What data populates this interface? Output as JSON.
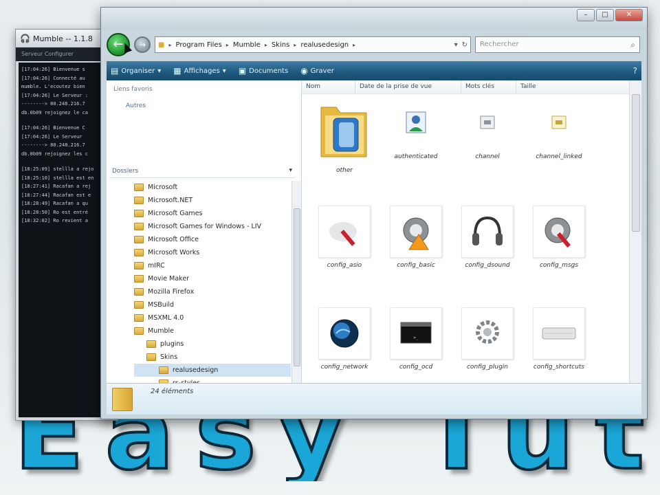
{
  "mumble": {
    "title": "Mumble -- 1.1.8",
    "menu": "Serveur  Configurer",
    "log_lines": [
      "[17:04:26] Bienvenue s",
      "[17:04:26] Connecté au",
      "mumble. L'ecoutez bien",
      "[17:04:26] Le Serveur :",
      "--------> 80.248.216.7",
      "db.0b09 rejoignez le ca",
      "",
      "[17:04:26] Bienvenue C",
      "[17:04:26] Le Serveur",
      "--------> 80.248.216.7",
      "db.0b09 rejoignez les c",
      "",
      "[18:25:09] stellla a rejo",
      "[18:25:10] stellla est en",
      "[18:27:41] Racafan a rej",
      "[18:27:44] Racafan est e",
      "[18:28:49] Racafan a qu",
      "[18:28:50] Ro est entré",
      "[18:32:02] Ro revient a"
    ]
  },
  "explorer": {
    "address": {
      "parts": [
        "Program Files",
        "Mumble",
        "Skins",
        "realusedesign"
      ]
    },
    "search_placeholder": "Rechercher",
    "toolbar": {
      "organize": "Organiser",
      "views": "Affichages",
      "burn": "Graver",
      "documents": "Documents"
    },
    "nav": {
      "favorites_header": "Liens favoris",
      "favorites_item": "Autres",
      "folders_header": "Dossiers",
      "folders": [
        {
          "label": "Microsoft",
          "level": 0
        },
        {
          "label": "Microsoft.NET",
          "level": 0
        },
        {
          "label": "Microsoft Games",
          "level": 0
        },
        {
          "label": "Microsoft Games for Windows - LIV",
          "level": 0
        },
        {
          "label": "Microsoft Office",
          "level": 0
        },
        {
          "label": "Microsoft Works",
          "level": 0
        },
        {
          "label": "mIRC",
          "level": 0
        },
        {
          "label": "Movie Maker",
          "level": 0
        },
        {
          "label": "Mozilla Firefox",
          "level": 0
        },
        {
          "label": "MSBuild",
          "level": 0
        },
        {
          "label": "MSXML 4.0",
          "level": 0
        },
        {
          "label": "Mumble",
          "level": 0
        },
        {
          "label": "plugins",
          "level": 1
        },
        {
          "label": "Skins",
          "level": 1
        },
        {
          "label": "realusedesign",
          "level": 2
        },
        {
          "label": "rs-styles",
          "level": 2
        }
      ]
    },
    "columns": [
      "Nom",
      "Date de la prise de vue",
      "Mots clés",
      "Taille"
    ],
    "files": [
      {
        "name": "other",
        "icon": "folder-icon"
      },
      {
        "name": "authenticated",
        "icon": "user-icon"
      },
      {
        "name": "channel",
        "icon": "channel-icon"
      },
      {
        "name": "channel_linked",
        "icon": "channel-linked-icon"
      },
      {
        "name": "config_asio",
        "icon": "asio-icon"
      },
      {
        "name": "config_basic",
        "icon": "speaker-warning-icon"
      },
      {
        "name": "config_dsound",
        "icon": "headphones-icon"
      },
      {
        "name": "config_msgs",
        "icon": "speaker-pen-icon"
      },
      {
        "name": "config_network",
        "icon": "globe-icon"
      },
      {
        "name": "config_ocd",
        "icon": "terminal-icon"
      },
      {
        "name": "config_plugin",
        "icon": "gear-icon"
      },
      {
        "name": "config_shortcuts",
        "icon": "keyboard-icon"
      }
    ],
    "status": {
      "count": "24 éléments"
    }
  }
}
